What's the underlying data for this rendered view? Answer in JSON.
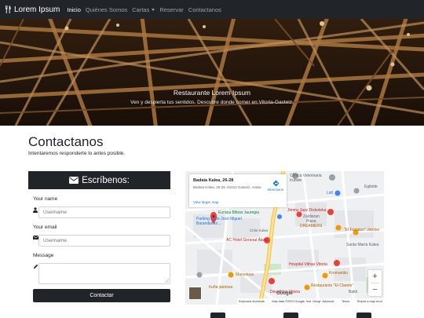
{
  "navbar": {
    "brand": "Lorem Ipsum",
    "items": [
      {
        "label": "Inicio",
        "active": true
      },
      {
        "label": "Quiénes Somos",
        "active": false
      },
      {
        "label": "Cartas",
        "active": false,
        "dropdown": true
      },
      {
        "label": "Reservar",
        "active": false
      },
      {
        "label": "Contactanos",
        "active": false
      }
    ]
  },
  "hero": {
    "title": "Restaurante Lorem Ipsum",
    "subtitle": "Ven y despierta tus sentidos. Descubre donde comer en Vitoria-Gasteiz."
  },
  "contact": {
    "title": "Contactanos",
    "subtitle": "Intentaremos responderte lo antes posible."
  },
  "form": {
    "header": "Escríbenos:",
    "name_label": "Your name",
    "name_placeholder": "Username",
    "email_label": "Your email",
    "email_placeholder": "Username",
    "message_label": "Message",
    "submit_label": "Contactar"
  },
  "map": {
    "place_title": "Badaia Kalea, 26-28",
    "place_address": "Badaia Kalea, 26-28, 01012 Gasteiz, Araba",
    "directions_label": "Directions",
    "larger_map_label": "View larger map",
    "labels": {
      "clinica": "Clínica Veterinaria",
      "clinica_sub": "Irubide",
      "lidl": "Lidl",
      "egibide": "Egibide",
      "jimmy": "Jimmy Jazz Diskoteka",
      "zaldiaran": "Zaldiaran",
      "plaza": "Plaza",
      "dreamers": "DREAMERS",
      "fortalon": "\"El Fortalon\" Jatetxe",
      "europa": "Europa Biltzar Jauregia",
      "parking": "Parking Calle José Miguel Barandiaran...",
      "chile": "Chile Kalea",
      "ac_hotel": "AC Hotel General Álava",
      "santa_maria": "Santa María Kalea",
      "hospital": "Hospital Vithas Vitoria",
      "marvelous": "Marvelous",
      "kromaniko": "Kromaniko",
      "iruna": "Iruña jatetxea",
      "clarete": "Restaurante \"El Clarete\"",
      "decathlon": "Decathlon Vitoria",
      "bakh": "Bakh",
      "gorbea": "Gorbea Kalea"
    },
    "attribution": {
      "shortcuts": "Keyboard shortcuts",
      "data": "Map data ©2023 Google, Inst. Geogr. Nacional",
      "terms": "Terms",
      "report": "Report a map error"
    },
    "google": "Google"
  },
  "colors": {
    "dark": "#212529",
    "nav_muted": "rgba(255,255,255,0.55)",
    "link": "#1a73e8"
  }
}
